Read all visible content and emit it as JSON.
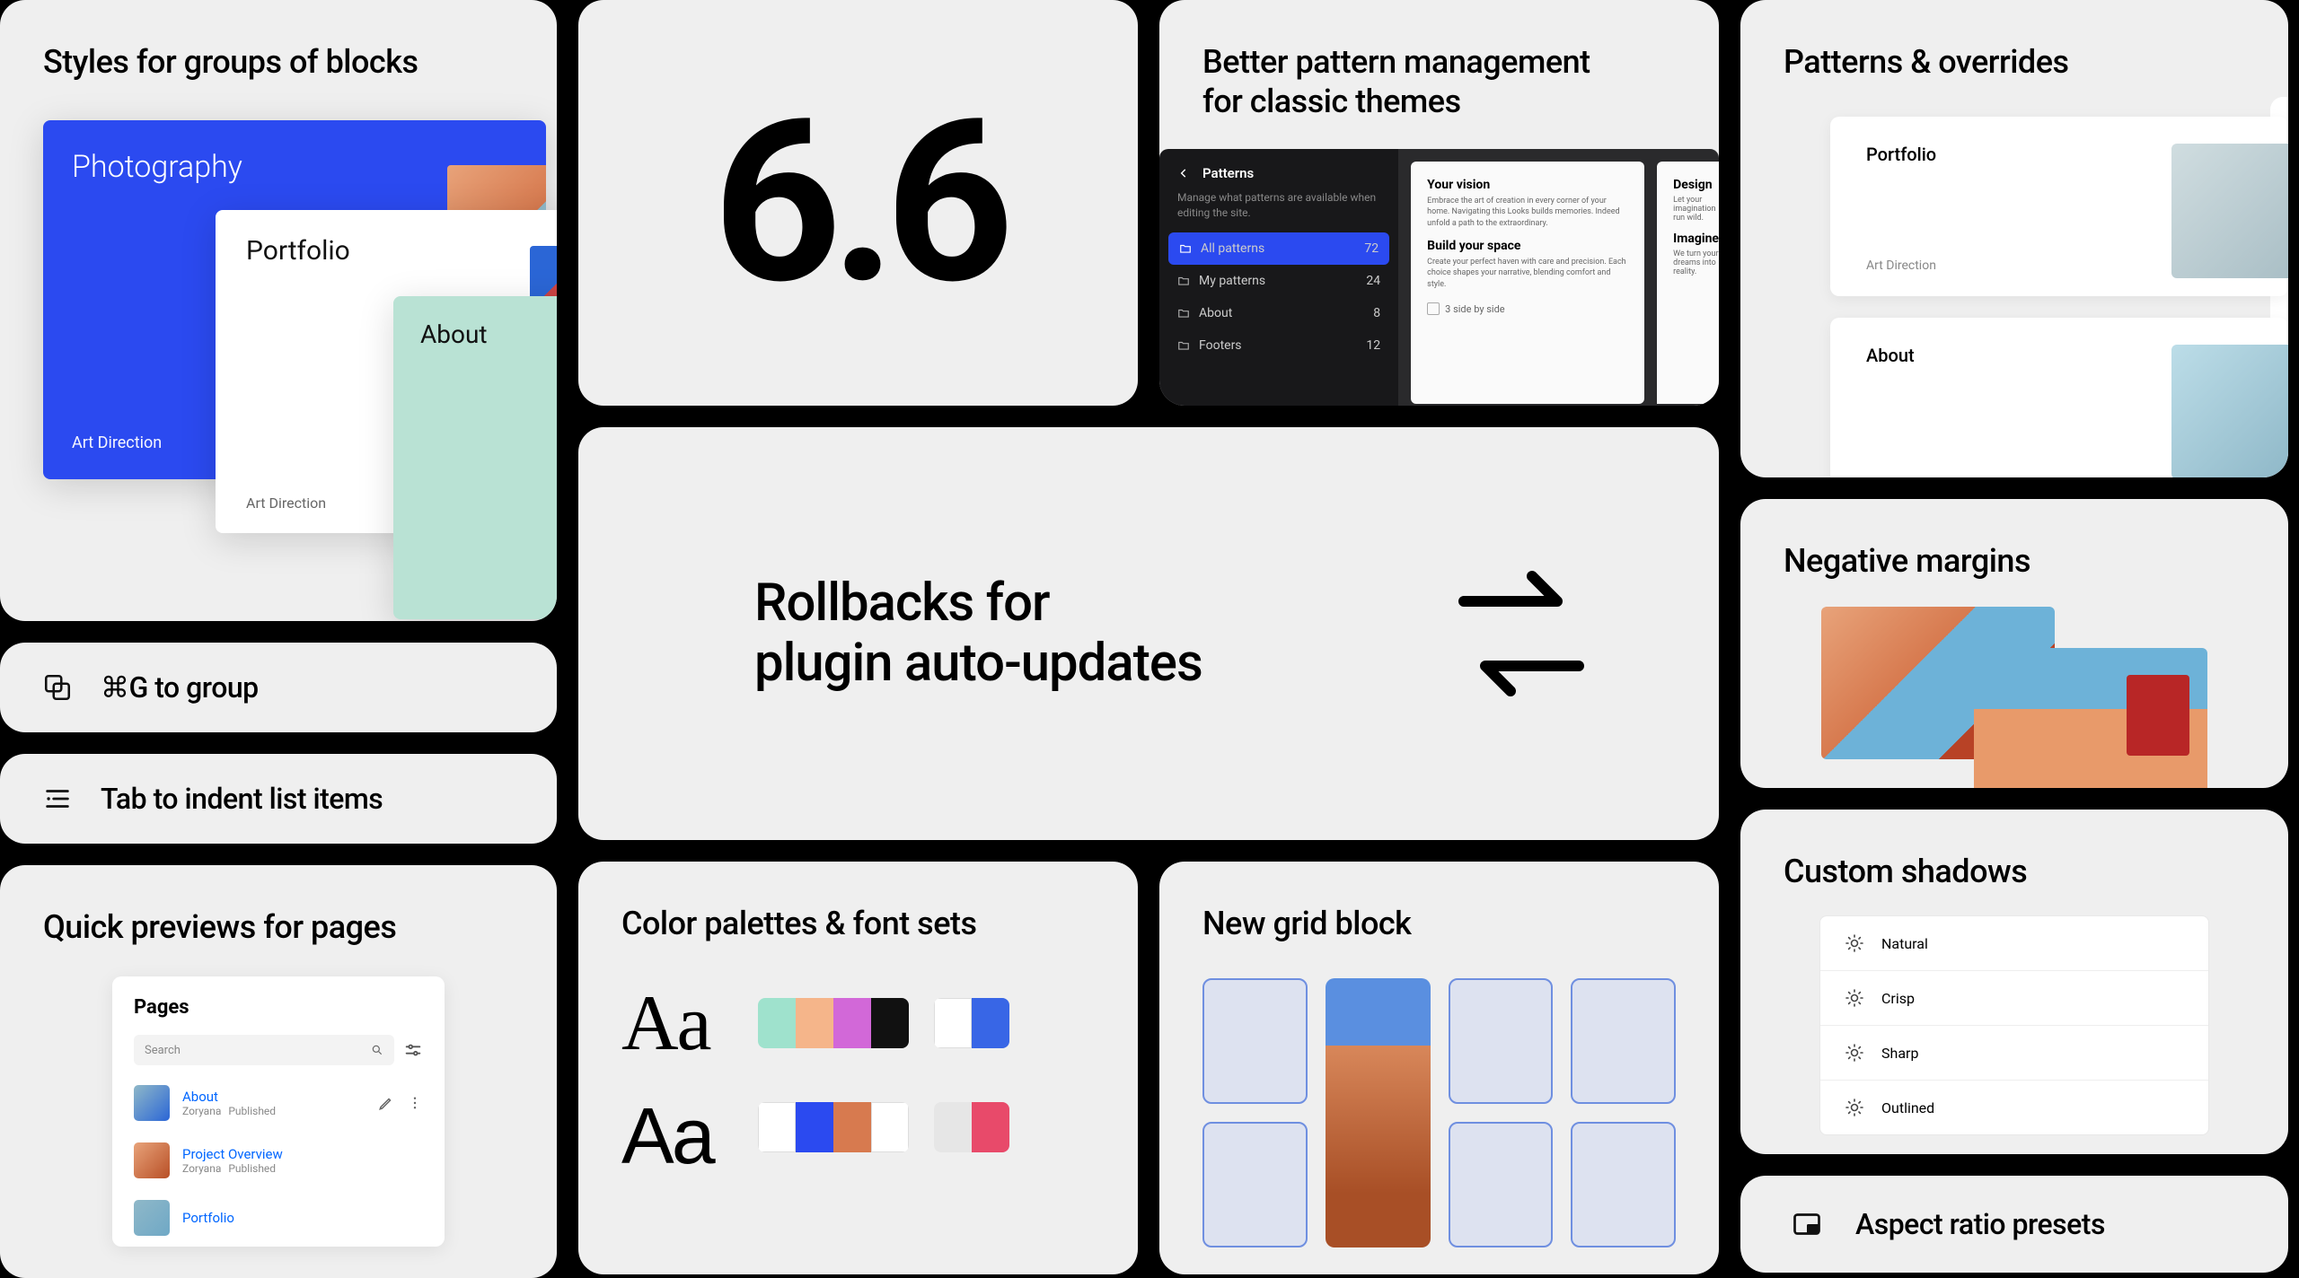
{
  "col1": {
    "styles": {
      "title": "Styles for groups of blocks",
      "cards": {
        "photography": {
          "title": "Photography",
          "sub": "Art Direction"
        },
        "portfolio": {
          "title": "Portfolio",
          "sub": "Art Direction"
        },
        "about": {
          "title": "About"
        }
      }
    },
    "groupShortcut": {
      "label": "⌘G to group"
    },
    "tabIndent": {
      "label": "Tab to indent list items"
    },
    "previews": {
      "title": "Quick previews for pages",
      "panelTitle": "Pages",
      "searchPlaceholder": "Search",
      "items": [
        {
          "title": "About",
          "author": "Zoryana",
          "status": "Published"
        },
        {
          "title": "Project Overview",
          "author": "Zoryana",
          "status": "Published"
        },
        {
          "title": "Portfolio",
          "author": "",
          "status": ""
        }
      ]
    }
  },
  "mid": {
    "version": "6.6",
    "patmgmt": {
      "title1": "Better pattern management",
      "title2": "for classic themes",
      "sidebar": {
        "header": "Patterns",
        "desc": "Manage what patterns are available when editing the site.",
        "rows": [
          {
            "label": "All patterns",
            "count": "72",
            "active": true
          },
          {
            "label": "My patterns",
            "count": "24",
            "active": false
          },
          {
            "label": "About",
            "count": "8",
            "active": false
          },
          {
            "label": "Footers",
            "count": "12",
            "active": false
          }
        ]
      },
      "doc": {
        "h1": "Your vision",
        "p1": "Embrace the art of creation in every corner of your home. Navigating this Looks builds memories. Indeed unfold a path to the extraordinary.",
        "h2": "Build your space",
        "p2": "Create your perfect haven with care and precision. Each choice shapes your narrative, blending comfort and style.",
        "check": "3 side by side"
      },
      "docRt": {
        "h1": "Design",
        "p1": "Let your imagination run wild.",
        "h2": "Imagine",
        "p2": "We turn your dreams into reality."
      }
    },
    "rollbacks": {
      "line1": "Rollbacks for",
      "line2": "plugin auto-updates"
    },
    "palettes": {
      "title": "Color palettes & font sets",
      "aa": "Aa",
      "palette1": [
        "#9fe2cd",
        "#f5b58a",
        "#d268d8",
        "#111111"
      ],
      "palette1b": [
        "#ffffff",
        "#3866e6"
      ],
      "palette2": [
        "#ffffff",
        "#2b4af0",
        "#d77a4f",
        "#ffffff"
      ],
      "palette2b": [
        "#e6e6e6",
        "#e84a6a"
      ]
    },
    "gridBlock": {
      "title": "New grid block"
    }
  },
  "col3": {
    "pov": {
      "title": "Patterns & overrides",
      "cards": [
        {
          "title": "Portfolio",
          "sub": "Art Direction"
        },
        {
          "title": "About",
          "sub": ""
        }
      ]
    },
    "neg": {
      "title": "Negative margins"
    },
    "shadows": {
      "title": "Custom shadows",
      "options": [
        "Natural",
        "Crisp",
        "Sharp",
        "Outlined"
      ]
    },
    "aspect": {
      "title": "Aspect ratio presets"
    }
  }
}
